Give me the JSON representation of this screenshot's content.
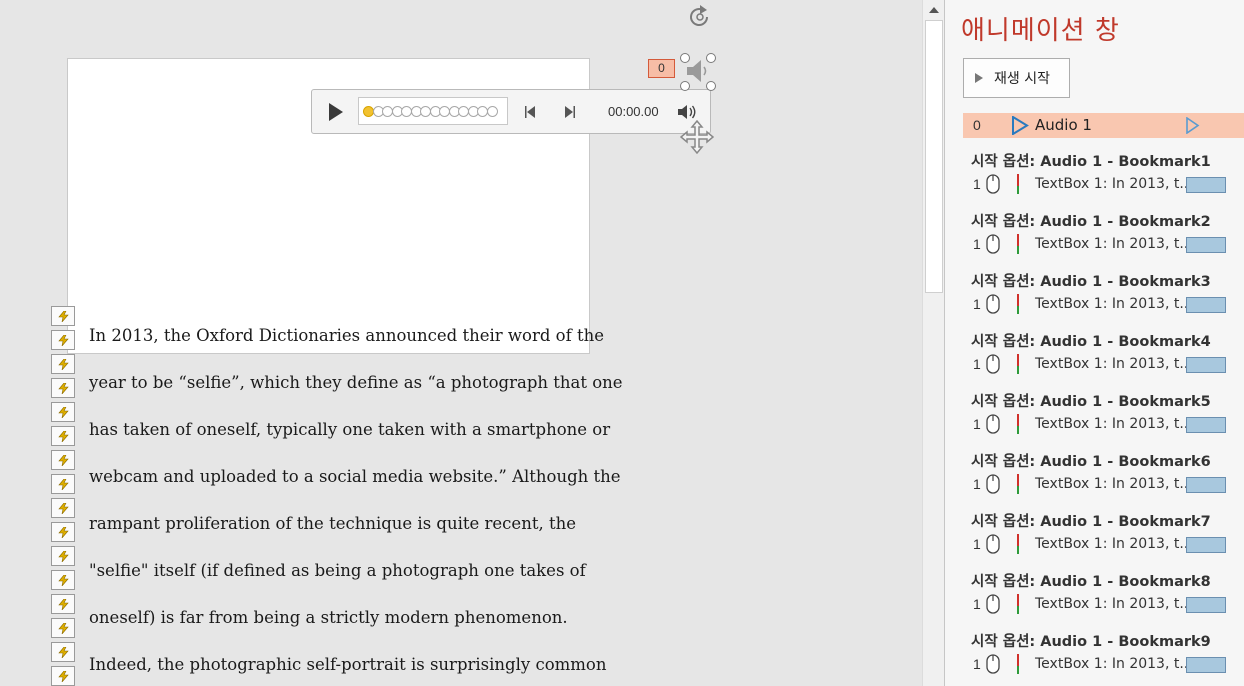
{
  "slide": {
    "text_lines": [
      "In 2013, the Oxford Dictionaries announced their word of the",
      "year to be “selfie”, which they define as “a photograph that one",
      "has taken of oneself, typically one taken with a smartphone or",
      "webcam and uploaded to a social media website.” Although the",
      "rampant proliferation of the technique is quite recent, the",
      "\"selfie\" itself (if defined as being a photograph one takes of",
      "oneself) is far from being a strictly modern phenomenon.",
      "Indeed, the photographic self-portrait is surprisingly common"
    ],
    "animation_badge": "0",
    "trigger_icon": "lightning-icon",
    "trigger_count": 16
  },
  "media_player": {
    "time": "00:00.00",
    "progress_fraction": 0,
    "icons": [
      "play-icon",
      "previous-icon",
      "next-icon",
      "volume-icon"
    ]
  },
  "animation_pane": {
    "title": "애니메이션 창",
    "play_button_label": "재생 시작",
    "audio_item": {
      "index": "0",
      "label": "Audio 1"
    },
    "groups": [
      {
        "header": "시작 옵션: Audio 1 - Bookmark1",
        "index": "1",
        "item": "TextBox 1: In 2013, t..."
      },
      {
        "header": "시작 옵션: Audio 1 - Bookmark2",
        "index": "1",
        "item": "TextBox 1: In 2013, t..."
      },
      {
        "header": "시작 옵션: Audio 1 - Bookmark3",
        "index": "1",
        "item": "TextBox 1: In 2013, t..."
      },
      {
        "header": "시작 옵션: Audio 1 - Bookmark4",
        "index": "1",
        "item": "TextBox 1: In 2013, t..."
      },
      {
        "header": "시작 옵션: Audio 1 - Bookmark5",
        "index": "1",
        "item": "TextBox 1: In 2013, t..."
      },
      {
        "header": "시작 옵션: Audio 1 - Bookmark6",
        "index": "1",
        "item": "TextBox 1: In 2013, t..."
      },
      {
        "header": "시작 옵션: Audio 1 - Bookmark7",
        "index": "1",
        "item": "TextBox 1: In 2013, t..."
      },
      {
        "header": "시작 옵션: Audio 1 - Bookmark8",
        "index": "1",
        "item": "TextBox 1: In 2013, t..."
      },
      {
        "header": "시작 옵션: Audio 1 - Bookmark9",
        "index": "1",
        "item": "TextBox 1: In 2013, t..."
      }
    ]
  },
  "colors": {
    "pane_title": "#c0392b",
    "selected_row": "#f9c7b0",
    "timing_bar": "#a8c8de"
  }
}
